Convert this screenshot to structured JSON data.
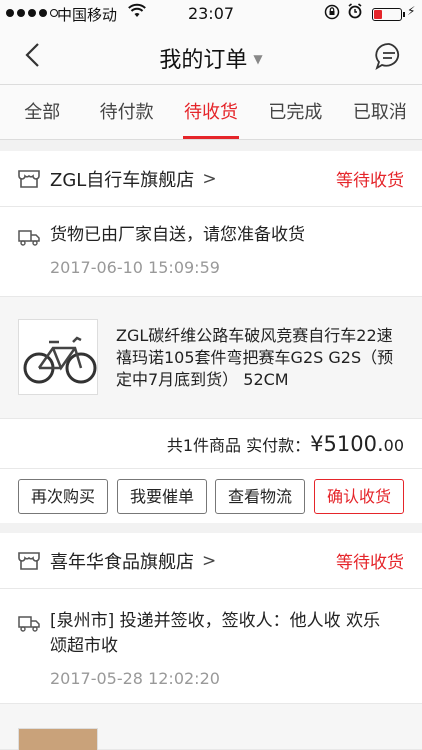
{
  "status_bar": {
    "carrier": "中国移动",
    "time": "23:07"
  },
  "header": {
    "title": "我的订单"
  },
  "tabs": [
    {
      "label": "全部"
    },
    {
      "label": "待付款"
    },
    {
      "label": "待收货"
    },
    {
      "label": "已完成"
    },
    {
      "label": "已取消"
    }
  ],
  "active_tab": "待收货",
  "orders": [
    {
      "shop": "ZGL自行车旗舰店",
      "status": "等待收货",
      "logistics_msg": "货物已由厂家自送，请您准备收货",
      "logistics_time": "2017-06-10 15:09:59",
      "product_name": "ZGL碳纤维公路车破风竞赛自行车22速禧玛诺105套件弯把赛车G2S G2S（预定中7月底到货） 52CM",
      "summary": "共1件商品  实付款：",
      "price_main": "¥5100.",
      "price_cents": "00",
      "buttons": {
        "rebuy": "再次购买",
        "remind": "我要催单",
        "track": "查看物流",
        "confirm": "确认收货"
      }
    },
    {
      "shop": "喜年华食品旗舰店",
      "status": "等待收货",
      "logistics_msg": "[泉州市] 投递并签收，签收人：他人收 欢乐颂超市收",
      "logistics_time": "2017-05-28 12:02:20"
    }
  ],
  "colors": {
    "accent": "#e5252a",
    "background": "#f2f2f2"
  }
}
